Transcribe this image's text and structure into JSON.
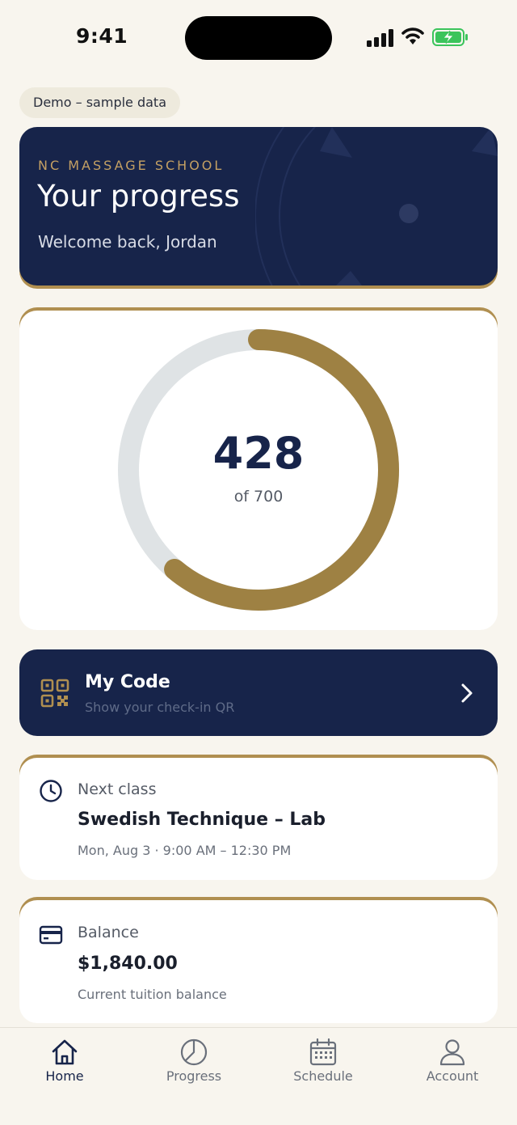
{
  "status_bar": {
    "time": "9:41"
  },
  "demo_chip": "Demo – sample data",
  "hero": {
    "eyebrow": "NC MASSAGE SCHOOL",
    "title": "Your progress",
    "welcome": "Welcome back, Jordan"
  },
  "progress": {
    "completed_hours": "428",
    "total_label": "of 700",
    "completed": 428,
    "total": 700,
    "colors": {
      "fill": "#9e8143",
      "track": "#dfe3e5"
    }
  },
  "my_code": {
    "title": "My Code",
    "subtitle": "Show your check-in QR",
    "icon": "qr-code-icon"
  },
  "next_class": {
    "label": "Next class",
    "name": "Swedish Technique – Lab",
    "when": "Mon, Aug 3 · 9:00 AM – 12:30 PM",
    "icon": "clock-icon"
  },
  "balance": {
    "label": "Balance",
    "amount": "$1,840.00",
    "description": "Current tuition balance",
    "icon": "credit-card-icon"
  },
  "tabs": [
    {
      "label": "Home",
      "icon": "home-icon",
      "active": true
    },
    {
      "label": "Progress",
      "icon": "pie-chart-icon",
      "active": false
    },
    {
      "label": "Schedule",
      "icon": "calendar-icon",
      "active": false
    },
    {
      "label": "Account",
      "icon": "user-icon",
      "active": false
    }
  ],
  "colors": {
    "navy": "#17244a",
    "gold": "#b08f50",
    "background": "#f8f5ee"
  }
}
